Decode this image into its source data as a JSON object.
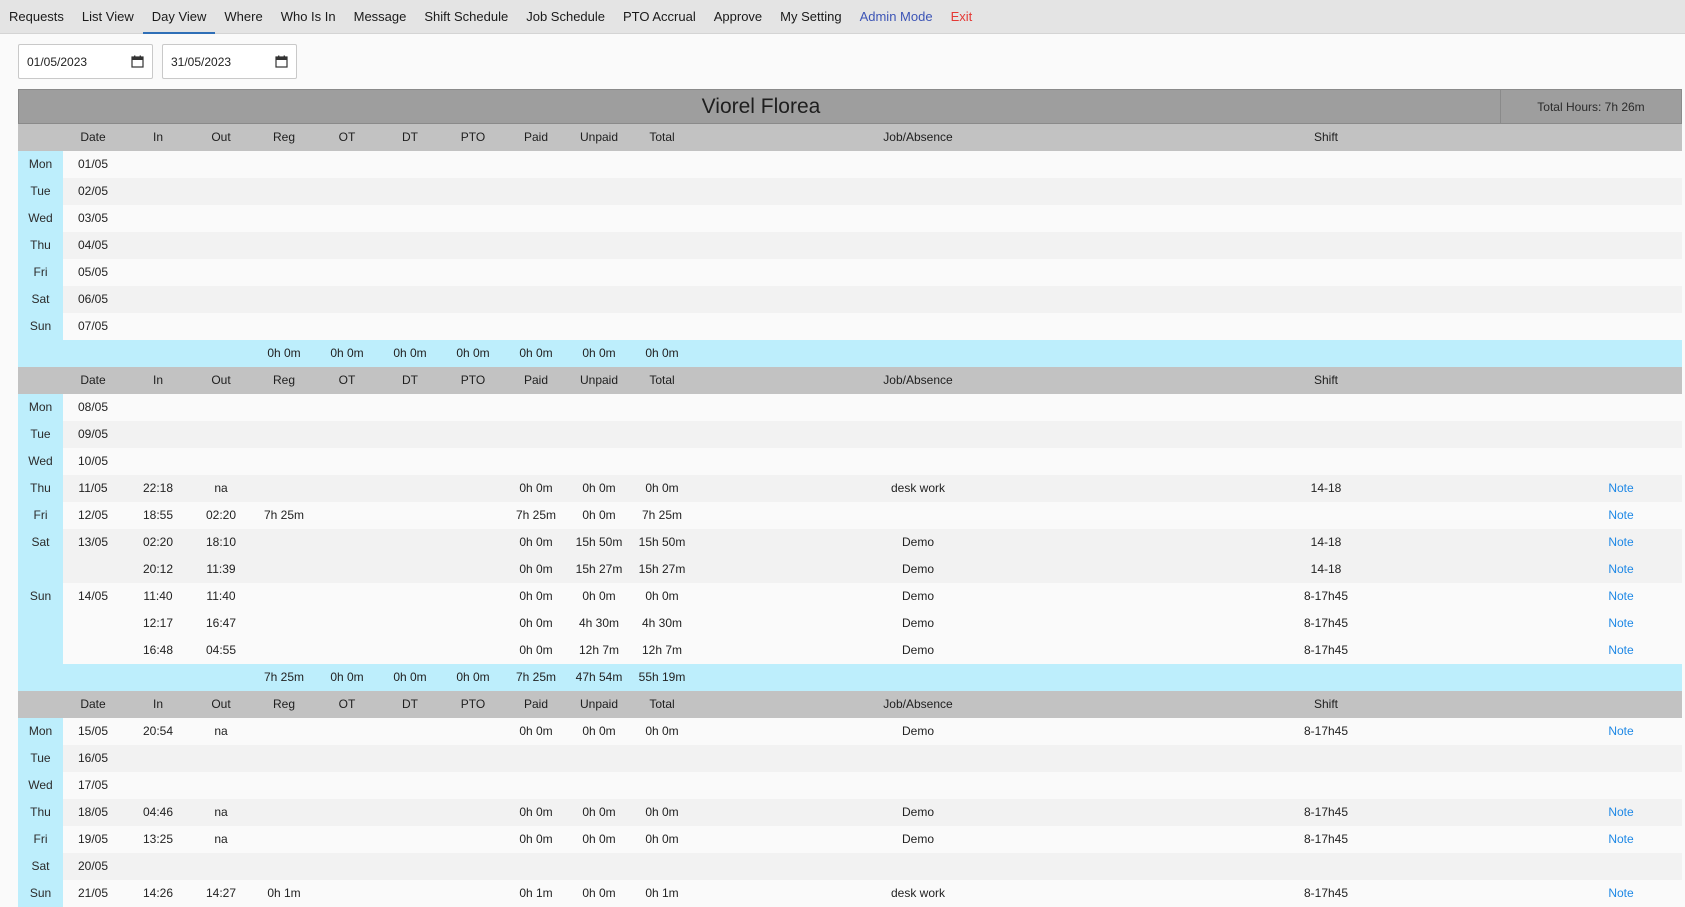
{
  "nav": [
    {
      "label": "Requests",
      "name": "nav-requests"
    },
    {
      "label": "List View",
      "name": "nav-list-view"
    },
    {
      "label": "Day View",
      "name": "nav-day-view",
      "active": true
    },
    {
      "label": "Where",
      "name": "nav-where"
    },
    {
      "label": "Who Is In",
      "name": "nav-who-is-in"
    },
    {
      "label": "Message",
      "name": "nav-message"
    },
    {
      "label": "Shift Schedule",
      "name": "nav-shift-schedule"
    },
    {
      "label": "Job Schedule",
      "name": "nav-job-schedule"
    },
    {
      "label": "PTO Accrual",
      "name": "nav-pto-accrual"
    },
    {
      "label": "Approve",
      "name": "nav-approve"
    },
    {
      "label": "My Setting",
      "name": "nav-my-setting"
    },
    {
      "label": "Admin Mode",
      "name": "nav-admin-mode",
      "style": "admin"
    },
    {
      "label": "Exit",
      "name": "nav-exit",
      "style": "exit"
    }
  ],
  "filters": {
    "start_date": "01/05/2023",
    "end_date": "31/05/2023",
    "calendar_icon": "calendar-icon"
  },
  "report": {
    "employee_name": "Viorel Florea",
    "total_hours": "Total Hours: 7h 26m",
    "headers": {
      "date": "Date",
      "in": "In",
      "out": "Out",
      "reg": "Reg",
      "ot": "OT",
      "dt": "DT",
      "pto": "PTO",
      "paid": "Paid",
      "unpaid": "Unpaid",
      "total": "Total",
      "job": "Job/Absence",
      "shift": "Shift"
    },
    "note_label": "Note",
    "weeks": [
      {
        "rows": [
          {
            "dow": "Mon",
            "date": "01/05"
          },
          {
            "dow": "Tue",
            "date": "02/05"
          },
          {
            "dow": "Wed",
            "date": "03/05"
          },
          {
            "dow": "Thu",
            "date": "04/05"
          },
          {
            "dow": "Fri",
            "date": "05/05"
          },
          {
            "dow": "Sat",
            "date": "06/05"
          },
          {
            "dow": "Sun",
            "date": "07/05"
          }
        ],
        "summary": {
          "reg": "0h 0m",
          "ot": "0h 0m",
          "dt": "0h 0m",
          "pto": "0h 0m",
          "paid": "0h 0m",
          "unpaid": "0h 0m",
          "total": "0h 0m"
        }
      },
      {
        "rows": [
          {
            "dow": "Mon",
            "date": "08/05"
          },
          {
            "dow": "Tue",
            "date": "09/05"
          },
          {
            "dow": "Wed",
            "date": "10/05"
          },
          {
            "dow": "Thu",
            "date": "11/05",
            "in": "22:18",
            "out": "na",
            "paid": "0h 0m",
            "unpaid": "0h 0m",
            "total": "0h 0m",
            "job": "desk work",
            "shift": "14-18",
            "note": true
          },
          {
            "dow": "Fri",
            "date": "12/05",
            "in": "18:55",
            "out": "02:20",
            "reg": "7h 25m",
            "paid": "7h 25m",
            "unpaid": "0h 0m",
            "total": "7h 25m",
            "note": true
          },
          {
            "dow": "Sat",
            "date": "13/05",
            "in": "02:20",
            "out": "18:10",
            "paid": "0h 0m",
            "unpaid": "15h 50m",
            "total": "15h 50m",
            "job": "Demo",
            "shift": "14-18",
            "note": true
          },
          {
            "dow": "",
            "date": "",
            "in": "20:12",
            "out": "11:39",
            "paid": "0h 0m",
            "unpaid": "15h 27m",
            "total": "15h 27m",
            "job": "Demo",
            "shift": "14-18",
            "note": true,
            "cont": true
          },
          {
            "dow": "Sun",
            "date": "14/05",
            "in": "11:40",
            "out": "11:40",
            "paid": "0h 0m",
            "unpaid": "0h 0m",
            "total": "0h 0m",
            "job": "Demo",
            "shift": "8-17h45",
            "note": true
          },
          {
            "dow": "",
            "date": "",
            "in": "12:17",
            "out": "16:47",
            "paid": "0h 0m",
            "unpaid": "4h 30m",
            "total": "4h 30m",
            "job": "Demo",
            "shift": "8-17h45",
            "note": true,
            "cont": true
          },
          {
            "dow": "",
            "date": "",
            "in": "16:48",
            "out": "04:55",
            "paid": "0h 0m",
            "unpaid": "12h 7m",
            "total": "12h 7m",
            "job": "Demo",
            "shift": "8-17h45",
            "note": true,
            "cont": true
          }
        ],
        "summary": {
          "reg": "7h 25m",
          "ot": "0h 0m",
          "dt": "0h 0m",
          "pto": "0h 0m",
          "paid": "7h 25m",
          "unpaid": "47h 54m",
          "total": "55h 19m"
        }
      },
      {
        "rows": [
          {
            "dow": "Mon",
            "date": "15/05",
            "in": "20:54",
            "out": "na",
            "paid": "0h 0m",
            "unpaid": "0h 0m",
            "total": "0h 0m",
            "job": "Demo",
            "shift": "8-17h45",
            "note": true
          },
          {
            "dow": "Tue",
            "date": "16/05"
          },
          {
            "dow": "Wed",
            "date": "17/05"
          },
          {
            "dow": "Thu",
            "date": "18/05",
            "in": "04:46",
            "out": "na",
            "paid": "0h 0m",
            "unpaid": "0h 0m",
            "total": "0h 0m",
            "job": "Demo",
            "shift": "8-17h45",
            "note": true
          },
          {
            "dow": "Fri",
            "date": "19/05",
            "in": "13:25",
            "out": "na",
            "paid": "0h 0m",
            "unpaid": "0h 0m",
            "total": "0h 0m",
            "job": "Demo",
            "shift": "8-17h45",
            "note": true
          },
          {
            "dow": "Sat",
            "date": "20/05"
          },
          {
            "dow": "Sun",
            "date": "21/05",
            "in": "14:26",
            "out": "14:27",
            "reg": "0h 1m",
            "paid": "0h 1m",
            "unpaid": "0h 0m",
            "total": "0h 1m",
            "job": "desk work",
            "shift": "8-17h45",
            "note": true
          }
        ]
      }
    ]
  }
}
